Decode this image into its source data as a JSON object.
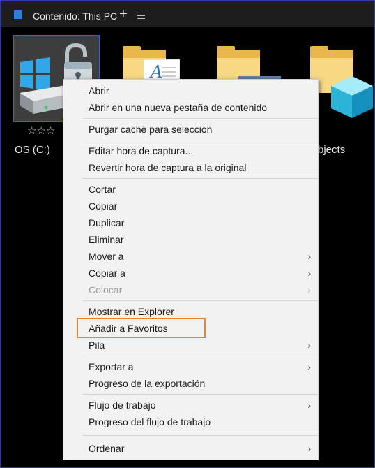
{
  "header": {
    "title": "Contenido: This PC",
    "plus": "+"
  },
  "grid": {
    "items": [
      {
        "label": "OS (C:)",
        "rating": "☆☆☆"
      },
      {
        "label": "bjects"
      }
    ]
  },
  "context_menu": {
    "items": [
      {
        "label": "Abrir"
      },
      {
        "label": "Abrir en una nueva pestaña de contenido"
      },
      {
        "label": "Purgar caché para selección"
      },
      {
        "label": "Editar hora de captura..."
      },
      {
        "label": "Revertir hora de captura a la original"
      },
      {
        "label": "Cortar"
      },
      {
        "label": "Copiar"
      },
      {
        "label": "Duplicar"
      },
      {
        "label": "Eliminar"
      },
      {
        "label": "Mover a",
        "submenu": true
      },
      {
        "label": "Copiar a",
        "submenu": true
      },
      {
        "label": "Colocar",
        "submenu": true,
        "disabled": true
      },
      {
        "label": "Mostrar en Explorer"
      },
      {
        "label": "Añadir a Favoritos",
        "highlighted": true
      },
      {
        "label": "Pila",
        "submenu": true
      },
      {
        "label": "Exportar a",
        "submenu": true
      },
      {
        "label": "Progreso de la exportación"
      },
      {
        "label": "Flujo de trabajo",
        "submenu": true
      },
      {
        "label": "Progreso del flujo de trabajo"
      },
      {
        "label": "Ordenar",
        "submenu": true
      }
    ],
    "submenu_arrow": "›"
  },
  "colors": {
    "highlight_border": "#e8832f",
    "selection_border": "#3d63c7",
    "accent": "#2d7be5"
  }
}
